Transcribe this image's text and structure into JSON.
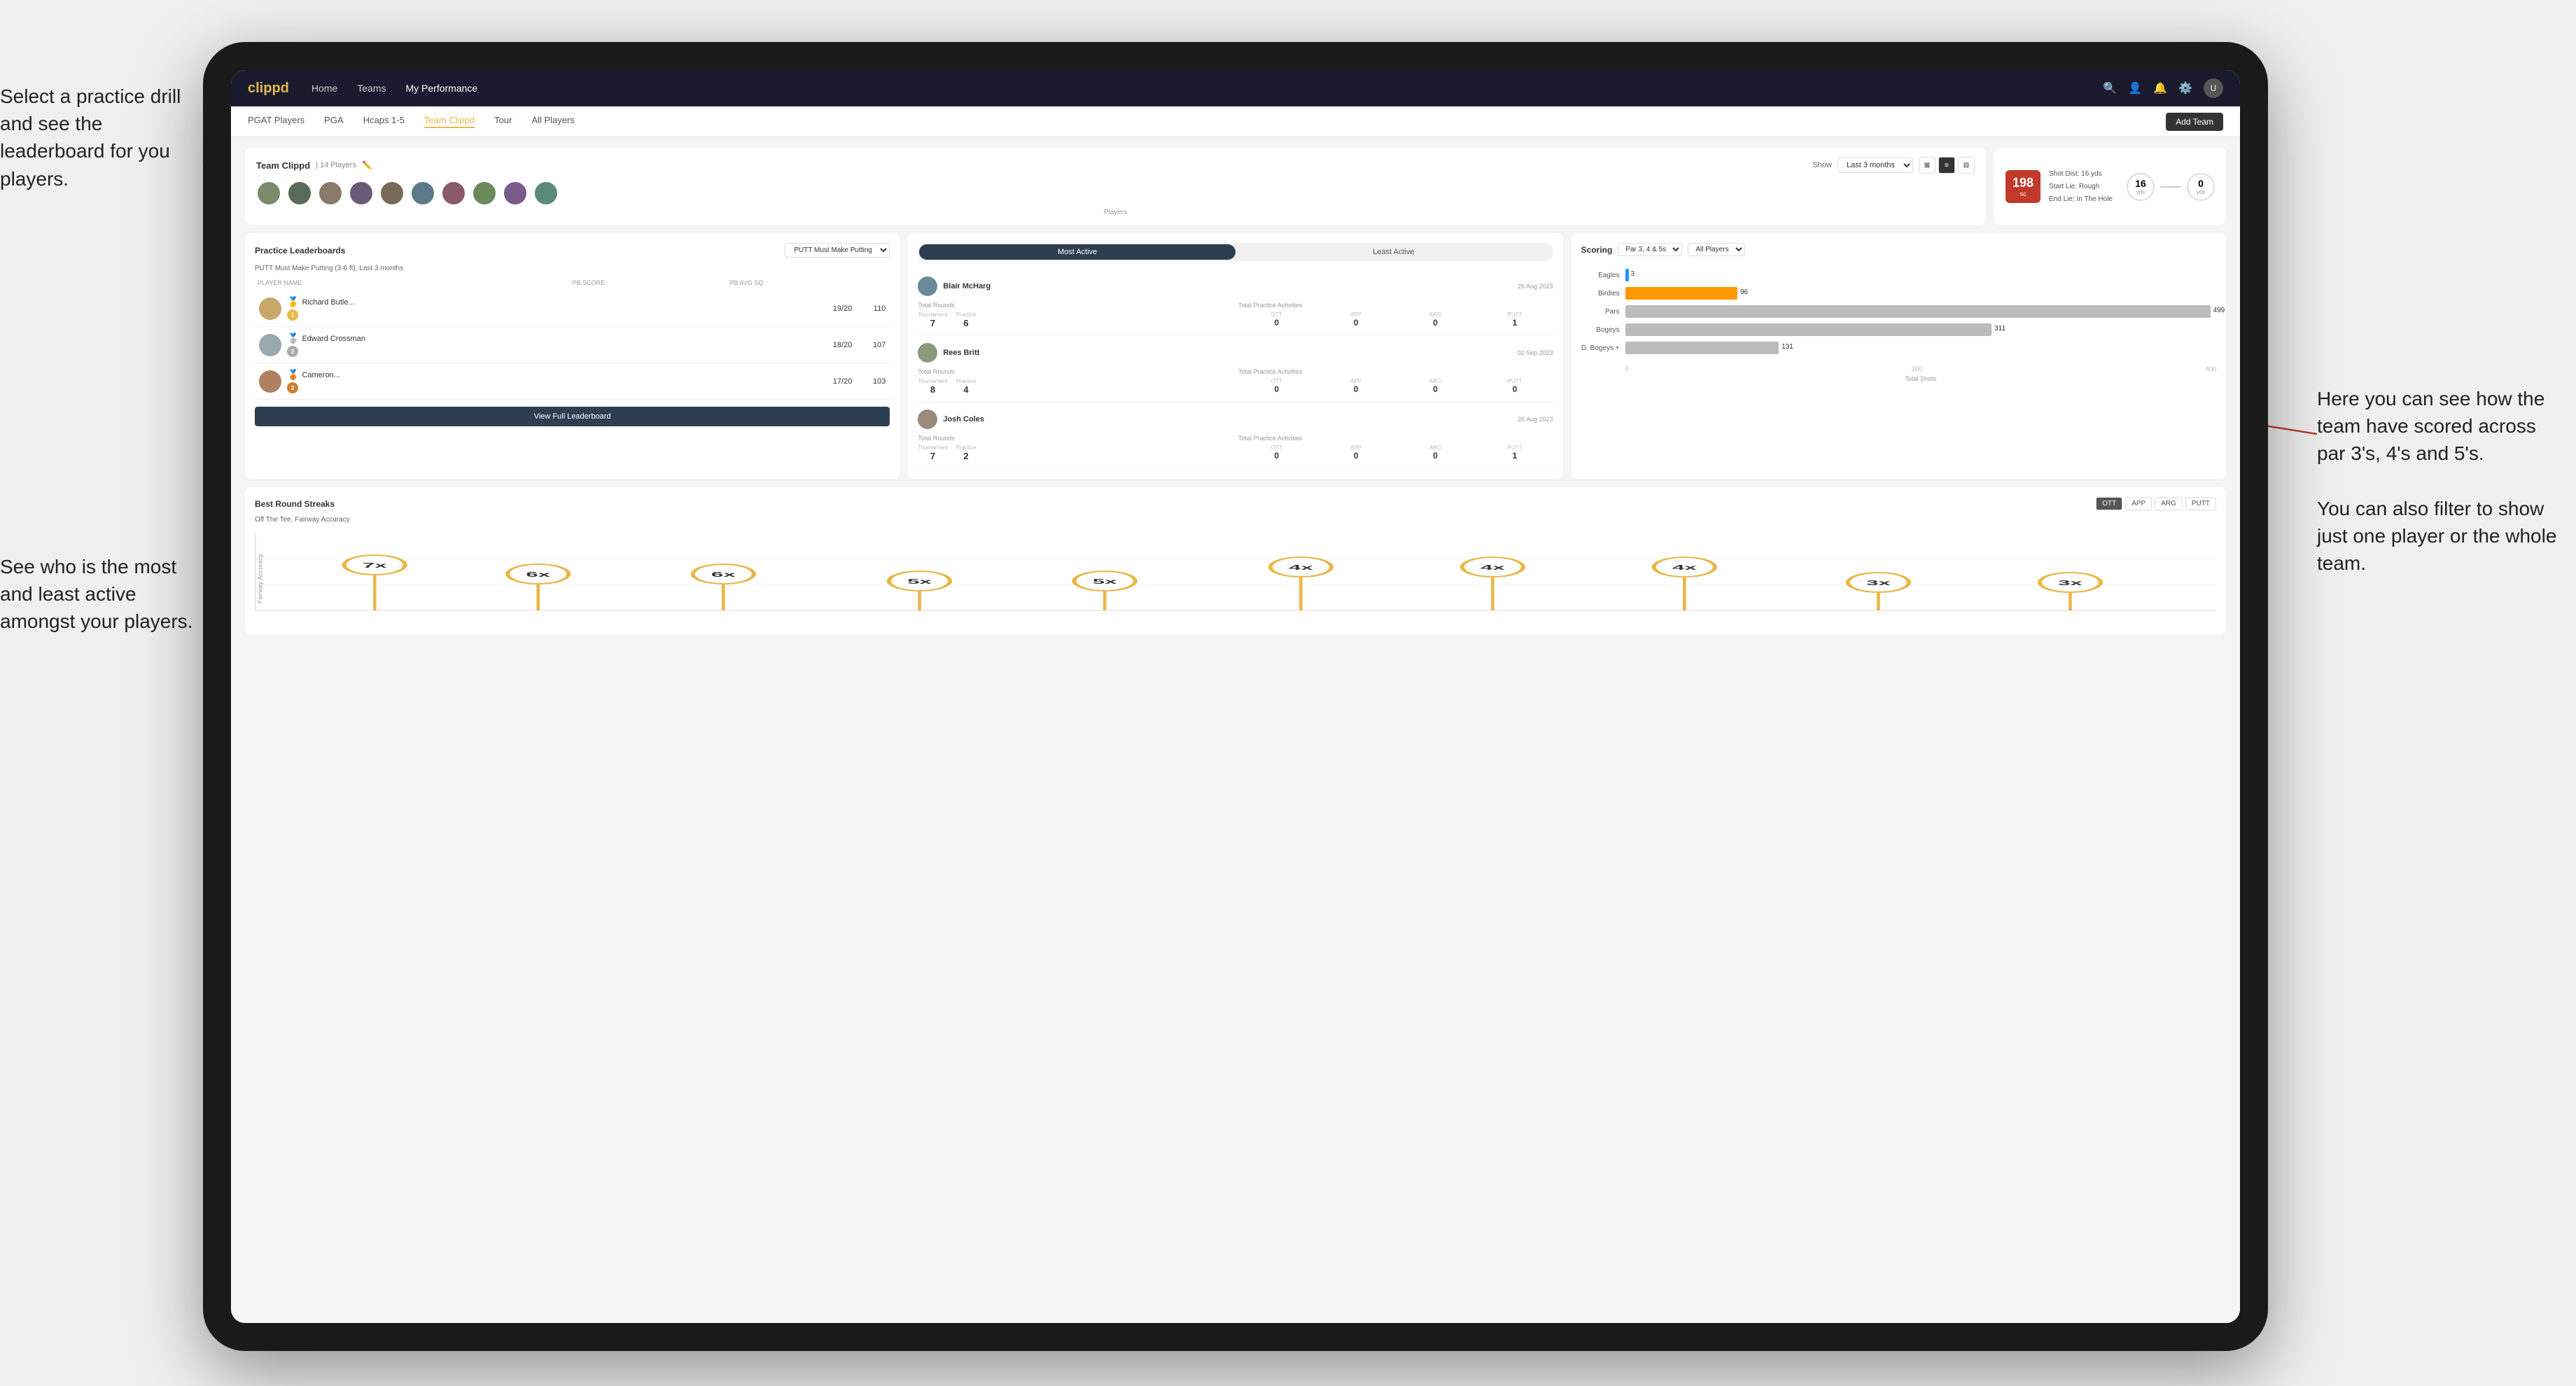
{
  "annotations": {
    "top_left": "Select a practice drill and see the leaderboard for you players.",
    "bottom_left": "See who is the most and least active amongst your players.",
    "right": "Here you can see how the team have scored across par 3's, 4's and 5's.\n\nYou can also filter to show just one player or the whole team."
  },
  "navbar": {
    "brand": "clippd",
    "links": [
      "Home",
      "Teams",
      "My Performance"
    ],
    "icons": [
      "search",
      "person",
      "bell",
      "settings",
      "avatar"
    ]
  },
  "subnav": {
    "links": [
      "PGAT Players",
      "PGA",
      "Hcaps 1-5",
      "Team Clippd",
      "Tour",
      "All Players"
    ],
    "active": "Team Clippd",
    "add_team": "Add Team"
  },
  "team_header": {
    "title": "Team Clippd",
    "player_count": "14 Players",
    "show_label": "Show",
    "time_filter": "Last 3 months",
    "players_label": "Players",
    "shot_dist_label": "Shot Dist:",
    "shot_dist_val": "16 yds",
    "start_lie_label": "Start Lie:",
    "start_lie_val": "Rough",
    "end_lie_label": "End Lie:",
    "end_lie_val": "In The Hole",
    "dist_badge": "198",
    "dist_unit": "sc",
    "yds_left": "16",
    "yds_right": "0",
    "yds_label": "yds"
  },
  "practice_leaderboard": {
    "title": "Practice Leaderboards",
    "drill": "PUTT Must Make Putting",
    "subtitle_full": "PUTT Must Make Putting (3-6 ft), Last 3 months",
    "col_player": "PLAYER NAME",
    "col_score": "PB SCORE",
    "col_avg": "PB AVG SQ",
    "players": [
      {
        "name": "Richard Butle...",
        "score": "19/20",
        "avg": "110",
        "rank": 1,
        "medal": "🥇"
      },
      {
        "name": "Edward Crossman",
        "score": "18/20",
        "avg": "107",
        "rank": 2,
        "medal": "🥈"
      },
      {
        "name": "Cameron...",
        "score": "17/20",
        "avg": "103",
        "rank": 3,
        "medal": "🥉"
      }
    ],
    "view_full": "View Full Leaderboard"
  },
  "activity": {
    "tabs": [
      "Most Active",
      "Least Active"
    ],
    "active_tab": "Most Active",
    "players": [
      {
        "name": "Blair McHarg",
        "date": "26 Aug 2023",
        "total_rounds_label": "Total Rounds",
        "tournament_label": "Tournament",
        "practice_label": "Practice",
        "tournament_val": "7",
        "practice_val": "6",
        "total_practice_label": "Total Practice Activities",
        "ott_label": "OTT",
        "app_label": "APP",
        "arg_label": "ARG",
        "putt_label": "PUTT",
        "ott_val": "0",
        "app_val": "0",
        "arg_val": "0",
        "putt_val": "1"
      },
      {
        "name": "Rees Britt",
        "date": "02 Sep 2023",
        "tournament_val": "8",
        "practice_val": "4",
        "ott_val": "0",
        "app_val": "0",
        "arg_val": "0",
        "putt_val": "0"
      },
      {
        "name": "Josh Coles",
        "date": "26 Aug 2023",
        "tournament_val": "7",
        "practice_val": "2",
        "ott_val": "0",
        "app_val": "0",
        "arg_val": "0",
        "putt_val": "1"
      }
    ]
  },
  "scoring": {
    "title": "Scoring",
    "filter_par": "Par 3, 4 & 5s",
    "filter_player": "All Players",
    "bars": [
      {
        "label": "Eagles",
        "value": 3,
        "max": 500,
        "color": "#2196F3"
      },
      {
        "label": "Birdies",
        "value": 96,
        "max": 500,
        "color": "#FF9800"
      },
      {
        "label": "Pars",
        "value": 499,
        "max": 500,
        "color": "#9E9E9E"
      },
      {
        "label": "Bogeys",
        "value": 311,
        "max": 500,
        "color": "#9E9E9E"
      },
      {
        "label": "D. Bogeys +",
        "value": 131,
        "max": 500,
        "color": "#9E9E9E"
      }
    ],
    "axis_labels": [
      "0",
      "200",
      "400"
    ],
    "x_label": "Total Shots"
  },
  "streaks": {
    "title": "Best Round Streaks",
    "subtitle": "Off The Tee, Fairway Accuracy",
    "filters": [
      "OTT",
      "APP",
      "ARG",
      "PUTT"
    ],
    "active_filter": "OTT",
    "points": [
      {
        "x": 6,
        "y": 65,
        "label": "7x"
      },
      {
        "x": 13,
        "y": 50,
        "label": "6x"
      },
      {
        "x": 21,
        "y": 50,
        "label": "6x"
      },
      {
        "x": 30,
        "y": 35,
        "label": "5x"
      },
      {
        "x": 38,
        "y": 35,
        "label": "5x"
      },
      {
        "x": 48,
        "y": 55,
        "label": "4x"
      },
      {
        "x": 56,
        "y": 55,
        "label": "4x"
      },
      {
        "x": 65,
        "y": 55,
        "label": "4x"
      },
      {
        "x": 74,
        "y": 70,
        "label": "3x"
      },
      {
        "x": 82,
        "y": 70,
        "label": "3x"
      }
    ]
  }
}
